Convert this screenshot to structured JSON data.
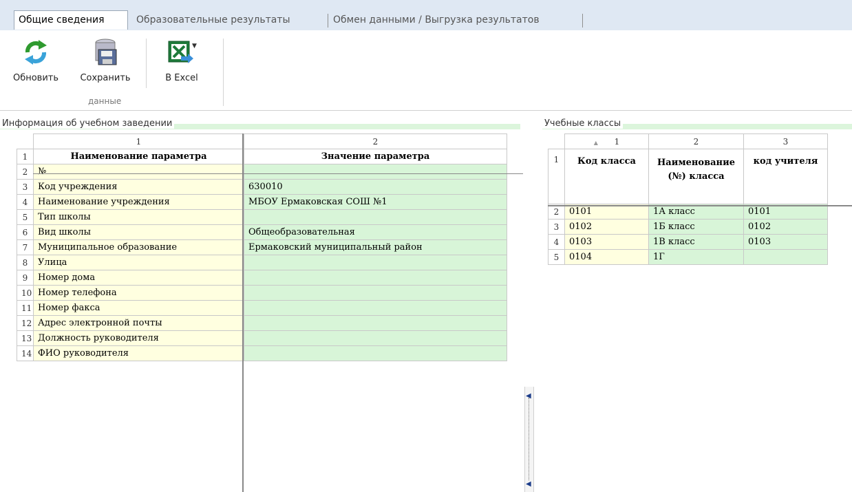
{
  "tabs": [
    {
      "label": "Общие сведения"
    },
    {
      "label": "Образовательные результаты"
    },
    {
      "label": "Обмен данными / Выгрузка результатов"
    }
  ],
  "ribbon": {
    "refresh_label": "Обновить",
    "save_label": "Сохранить",
    "excel_label": "В Excel",
    "group_label": "данные"
  },
  "left_panel": {
    "title": "Информация об учебном заведении",
    "col_numbers": [
      "1",
      "2"
    ],
    "headers": [
      "Наименование параметра",
      "Значение параметра"
    ],
    "rows": [
      {
        "n": "1"
      },
      {
        "n": "2",
        "param": "№",
        "value": ""
      },
      {
        "n": "3",
        "param": "Код учреждения",
        "value": "630010"
      },
      {
        "n": "4",
        "param": "Наименование учреждения",
        "value": "МБОУ Ермаковская СОШ №1"
      },
      {
        "n": "5",
        "param": "Тип школы",
        "value": ""
      },
      {
        "n": "6",
        "param": "Вид школы",
        "value": "Общеобразовательная"
      },
      {
        "n": "7",
        "param": "Муниципальное образование",
        "value": "Ермаковский муниципальный район"
      },
      {
        "n": "8",
        "param": "Улица",
        "value": ""
      },
      {
        "n": "9",
        "param": "Номер дома",
        "value": ""
      },
      {
        "n": "10",
        "param": "Номер телефона",
        "value": ""
      },
      {
        "n": "11",
        "param": "Номер факса",
        "value": ""
      },
      {
        "n": "12",
        "param": "Адрес электронной почты",
        "value": ""
      },
      {
        "n": "13",
        "param": "Должность руководителя",
        "value": ""
      },
      {
        "n": "14",
        "param": "ФИО руководителя",
        "value": ""
      }
    ]
  },
  "right_panel": {
    "title": "Учебные классы",
    "col_numbers": [
      "1",
      "2",
      "3"
    ],
    "sort_indicator": "▲",
    "headers": [
      "Код класса",
      "Наименование (№) класса",
      "код учителя"
    ],
    "header_row_number": "1",
    "rows": [
      {
        "n": "2",
        "code": "0101",
        "name": "1А класс",
        "teacher": "0101"
      },
      {
        "n": "3",
        "code": "0102",
        "name": "1Б класс",
        "teacher": "0102"
      },
      {
        "n": "4",
        "code": "0103",
        "name": "1В класс",
        "teacher": "0103"
      },
      {
        "n": "5",
        "code": "0104",
        "name": "1Г",
        "teacher": ""
      }
    ]
  },
  "colors": {
    "value_cell": "#d8f5d8",
    "param_cell": "#ffffe0",
    "tab_bar": "#dfe8f3"
  },
  "icons": [
    "refresh-icon",
    "save-database-icon",
    "excel-export-icon",
    "dropdown-arrow-icon",
    "collapse-left-icon"
  ]
}
